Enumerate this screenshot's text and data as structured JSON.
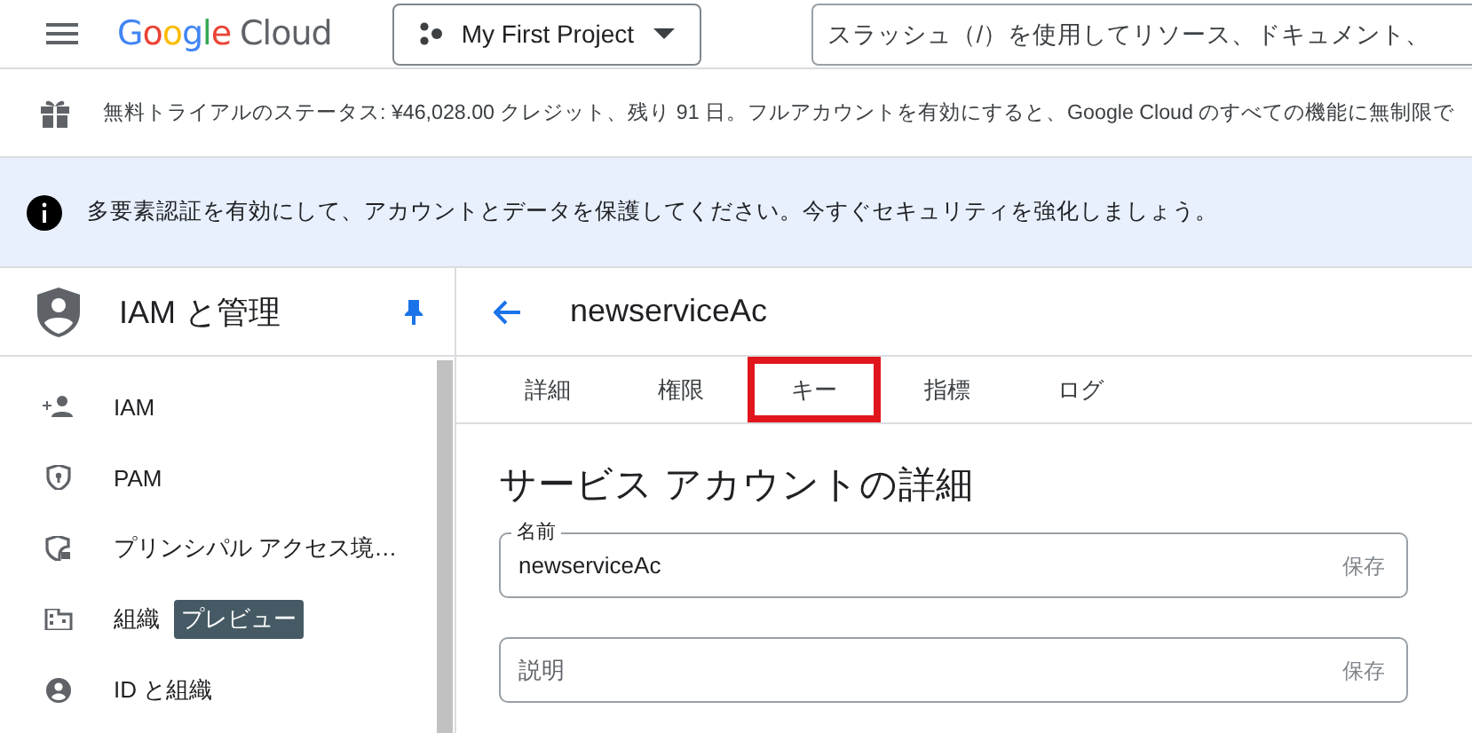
{
  "top_bar": {
    "logo": {
      "brand": "Google",
      "product": "Cloud"
    },
    "project": "My First Project",
    "search": {
      "placeholder": "スラッシュ（/）を使用してリソース、ドキュメント、"
    }
  },
  "trial_banner": {
    "text": "無料トライアルのステータス: ¥46,028.00 クレジット、残り 91 日。フルアカウントを有効にすると、Google Cloud のすべての機能に無制限で"
  },
  "alert_banner": {
    "text": "多要素認証を有効にして、アカウントとデータを保護してください。今すぐセキュリティを強化しましょう。"
  },
  "sidebar": {
    "title": "IAM と管理",
    "pinned": true,
    "items": [
      {
        "kind": "person-add",
        "label": "IAM"
      },
      {
        "kind": "shield-key",
        "label": "PAM"
      },
      {
        "kind": "shield-lock",
        "label": "プリンシパル アクセス境…"
      },
      {
        "kind": "building",
        "label": "組織",
        "badge": "プレビュー"
      },
      {
        "kind": "account",
        "label": "ID と組織"
      }
    ]
  },
  "content": {
    "title": "newserviceAc",
    "tabs": [
      {
        "label": "詳細",
        "highlighted": false
      },
      {
        "label": "権限",
        "highlighted": false
      },
      {
        "label": "キー",
        "highlighted": true
      },
      {
        "label": "指標",
        "highlighted": false
      },
      {
        "label": "ログ",
        "highlighted": false
      }
    ],
    "section_title": "サービス アカウントの詳細",
    "fields": [
      {
        "label": "名前",
        "value": "newserviceAc",
        "action": "保存"
      },
      {
        "placeholder": "説明",
        "action": "保存"
      }
    ]
  }
}
